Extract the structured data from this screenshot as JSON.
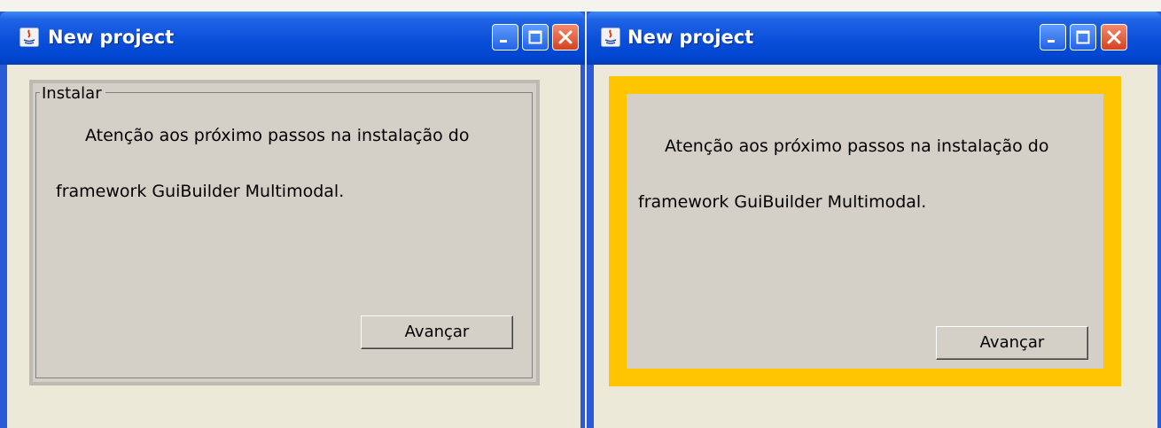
{
  "windows": [
    {
      "title": "New project",
      "group_label": "Instalar",
      "message_line1": "Atenção aos próximo passos na instalação do",
      "message_line2": "framework GuiBuilder Multimodal.",
      "next_button": "Avançar"
    },
    {
      "title": "New project",
      "message_line1": "Atenção aos próximo passos na instalação do",
      "message_line2": "framework GuiBuilder Multimodal.",
      "next_button": "Avançar",
      "highlight_color": "#ffc600"
    }
  ],
  "colors": {
    "titlebar": "#0a4fd8",
    "close_button": "#d3421f",
    "panel": "#d4d0c8",
    "window_bg": "#ece9d8"
  },
  "icons": [
    "java-app-icon",
    "minimize-icon",
    "maximize-icon",
    "close-icon"
  ]
}
